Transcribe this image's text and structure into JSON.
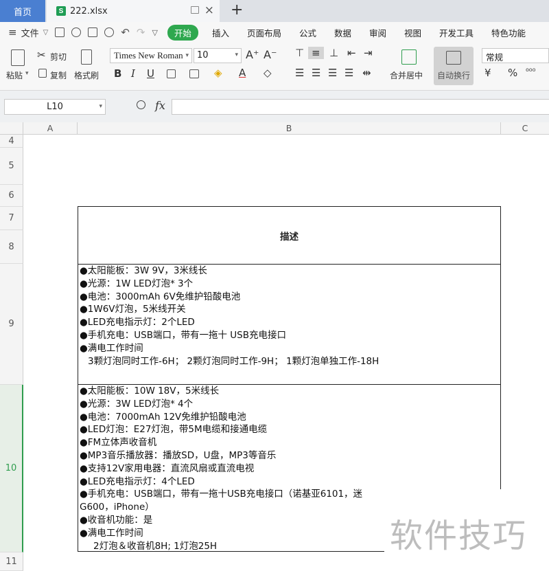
{
  "tabs": {
    "home": "首页",
    "file": "222.xlsx",
    "file_badge": "S"
  },
  "menubar": {
    "file": "文件",
    "items": [
      "开始",
      "插入",
      "页面布局",
      "公式",
      "数据",
      "审阅",
      "视图",
      "开发工具",
      "特色功能"
    ],
    "active_color": "#2fa84f"
  },
  "ribbon": {
    "paste": "粘贴",
    "cut": "剪切",
    "copy": "复制",
    "format_painter": "格式刷",
    "font_name": "Times New Roman",
    "font_size": "10",
    "merge_center": "合并居中",
    "wrap_text": "自动换行",
    "number_format": "常规",
    "bold": "B",
    "italic": "I",
    "underline": "U",
    "percent": "%"
  },
  "formula_bar": {
    "cell_ref": "L10",
    "fx": "fx",
    "value": ""
  },
  "grid": {
    "columns": [
      "A",
      "B",
      "C"
    ],
    "rows": [
      "4",
      "5",
      "6",
      "7",
      "8",
      "9",
      "10",
      "11"
    ],
    "active_row": "10",
    "active_color": "#2f9d4e"
  },
  "cells": {
    "title": "描述",
    "row9": [
      "●太阳能板：3W 9V，3米线长",
      "●光源：1W LED灯泡* 3个",
      "●电池：3000mAh 6V免维护铅酸电池",
      "●1W6V灯泡，5米线开关",
      "●LED充电指示灯：2个LED",
      "●手机充电：USB端口，带有一拖十 USB充电接口",
      "●满电工作时间",
      "3颗灯泡同时工作-6H； 2颗灯泡同时工作-9H； 1颗灯泡单独工作-18H"
    ],
    "row10": [
      "●太阳能板：10W 18V，5米线长",
      "●光源：3W LED灯泡* 4个",
      "●电池：7000mAh 12V免维护铅酸电池",
      "●LED灯泡：E27灯泡，带5M电缆和接通电缆",
      "●FM立体声收音机",
      "●MP3音乐播放器：播放SD，U盘，MP3等音乐",
      "●支持12V家用电器：直流风扇或直流电视",
      "●LED充电指示灯：4个LED",
      "●手机充电：USB端口，带有一拖十USB充电接口（诺基亚6101，迷",
      "G600，iPhone）",
      "●收音机功能：是",
      "●满电工作时间",
      "2灯泡＆收音机8H; 1灯泡25H"
    ]
  },
  "watermark": "软件技巧"
}
